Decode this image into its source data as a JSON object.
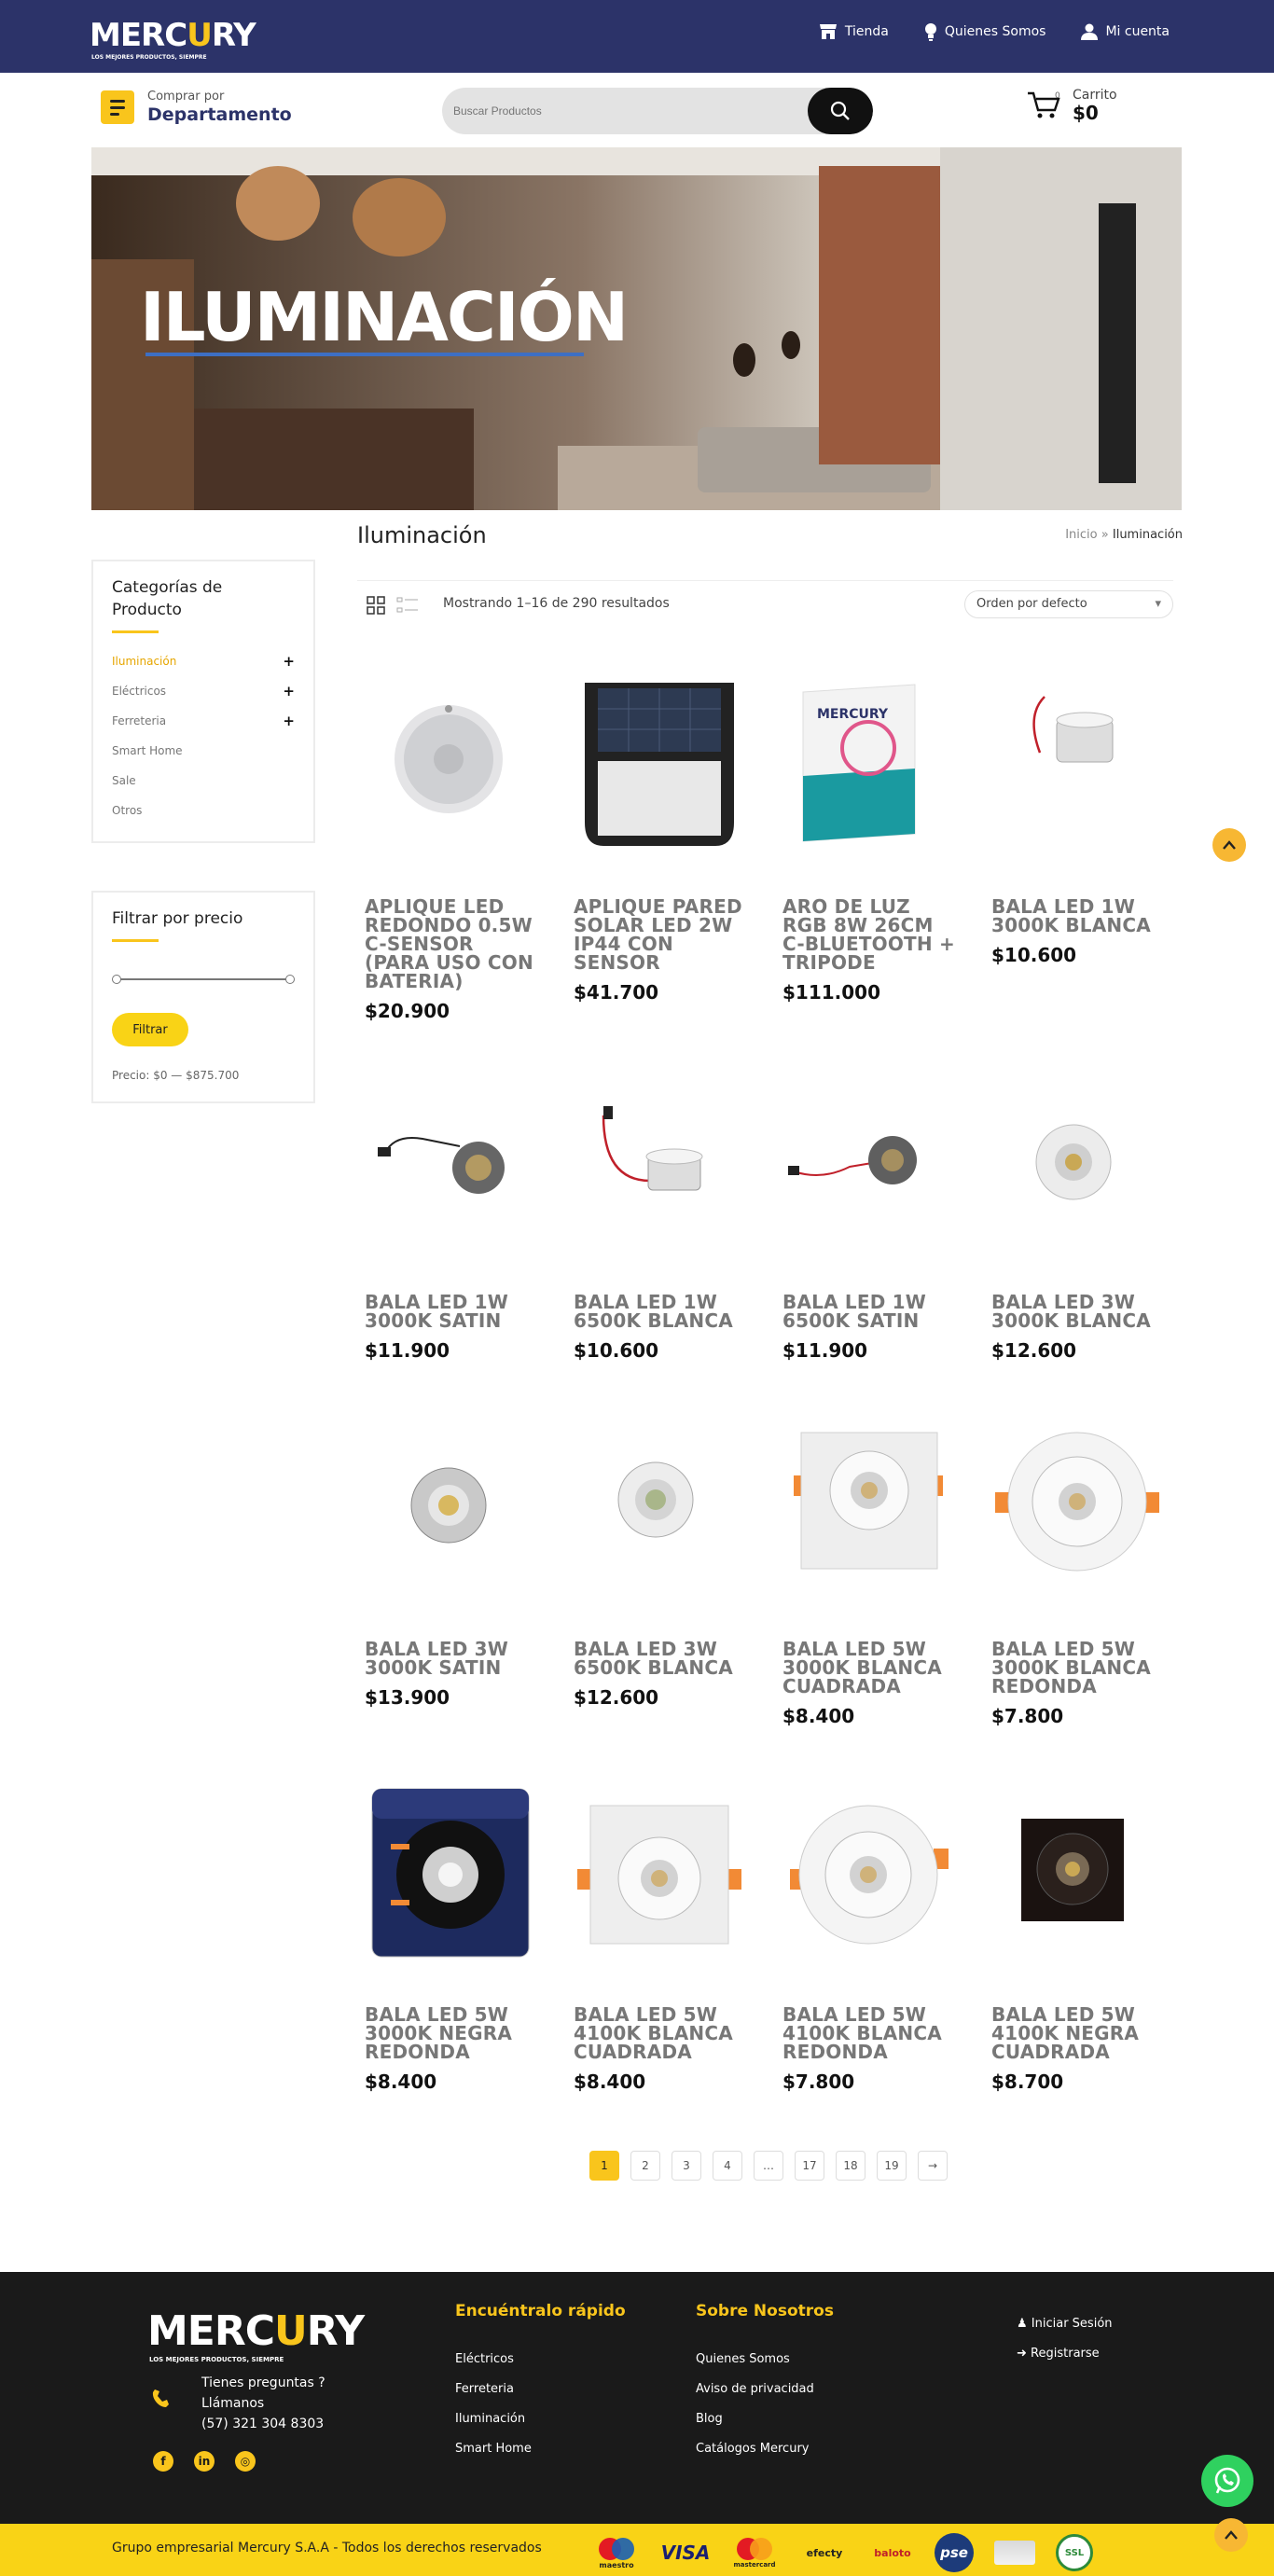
{
  "brand": {
    "logo_text": "MERCURY",
    "logo_tagline": "LOS MEJORES PRODUCTOS, SIEMPRE"
  },
  "topnav": [
    {
      "label": "Tienda",
      "icon": "store-icon"
    },
    {
      "label": "Quienes Somos",
      "icon": "lightbulb-icon"
    },
    {
      "label": "Mi cuenta",
      "icon": "user-icon"
    }
  ],
  "department": {
    "small": "Comprar por",
    "big": "Departamento"
  },
  "search": {
    "placeholder": "Buscar Productos"
  },
  "cart": {
    "label": "Carrito",
    "amount": "$0",
    "count": "0"
  },
  "banner": {
    "title": "ILUMINACIÓN"
  },
  "page": {
    "title": "Iluminación"
  },
  "breadcrumb": {
    "home": "Inicio",
    "sep": "»",
    "current": "Iluminación"
  },
  "categories": {
    "title": "Categorías de Producto",
    "items": [
      {
        "label": "Iluminación",
        "expand": "+"
      },
      {
        "label": "Eléctricos",
        "expand": "+"
      },
      {
        "label": "Ferreteria",
        "expand": "+"
      },
      {
        "label": "Smart Home",
        "expand": ""
      },
      {
        "label": "Sale",
        "expand": ""
      },
      {
        "label": "Otros",
        "expand": ""
      }
    ]
  },
  "price_filter": {
    "title": "Filtrar por precio",
    "button": "Filtrar",
    "range_text": "Precio: $0 — $875.700"
  },
  "toolbar": {
    "result_count": "Mostrando 1–16 de 290 resultados",
    "sort": "Orden por defecto"
  },
  "products": [
    {
      "name": "APLIQUE LED REDONDO 0.5W C-SENSOR (PARA USO CON BATERIA)",
      "price": "$20.900"
    },
    {
      "name": "APLIQUE PARED SOLAR LED 2W IP44 CON SENSOR",
      "price": "$41.700"
    },
    {
      "name": "ARO DE LUZ RGB 8W 26CM C-BLUETOOTH + TRIPODE",
      "price": "$111.000"
    },
    {
      "name": "BALA LED 1W 3000K BLANCA",
      "price": "$10.600"
    },
    {
      "name": "BALA LED 1W 3000K SATIN",
      "price": "$11.900"
    },
    {
      "name": "BALA LED 1W 6500K BLANCA",
      "price": "$10.600"
    },
    {
      "name": "BALA LED 1W 6500K SATIN",
      "price": "$11.900"
    },
    {
      "name": "BALA LED 3W 3000K BLANCA",
      "price": "$12.600"
    },
    {
      "name": "BALA LED 3W 3000K SATIN",
      "price": "$13.900"
    },
    {
      "name": "BALA LED 3W 6500K BLANCA",
      "price": "$12.600"
    },
    {
      "name": "BALA LED 5W 3000K BLANCA CUADRADA",
      "price": "$8.400"
    },
    {
      "name": "BALA LED 5W 3000K BLANCA REDONDA",
      "price": "$7.800"
    },
    {
      "name": "BALA LED 5W 3000K NEGRA REDONDA",
      "price": "$8.400"
    },
    {
      "name": "BALA LED 5W 4100K BLANCA CUADRADA",
      "price": "$8.400"
    },
    {
      "name": "BALA LED 5W 4100K BLANCA REDONDA",
      "price": "$7.800"
    },
    {
      "name": "BALA LED 5W 4100K NEGRA CUADRADA",
      "price": "$8.700"
    }
  ],
  "pagination": [
    "1",
    "2",
    "3",
    "4",
    "…",
    "17",
    "18",
    "19",
    "→"
  ],
  "footer": {
    "contact_q": "Tienes preguntas ?",
    "contact_call": "Llámanos",
    "phone": "(57) 321 304 8303",
    "quick": {
      "title": "Encuéntralo rápido",
      "links": [
        "Eléctricos",
        "Ferreteria",
        "Iluminación",
        "Smart Home"
      ]
    },
    "about": {
      "title": "Sobre Nosotros",
      "links": [
        "Quienes Somos",
        "Aviso de privacidad",
        "Blog",
        "Catálogos Mercury"
      ]
    },
    "account": [
      "Iniciar Sesión",
      "Registrarse"
    ],
    "copyright": "Grupo empresarial Mercury S.A.A - Todos los derechos reservados",
    "payments": [
      "maestro",
      "VISA",
      "mastercard",
      "efecty",
      "baloto",
      "pse",
      "",
      "SSL"
    ]
  },
  "colors": {
    "navy": "#2c3369",
    "yellow": "#f9c51c",
    "footer": "#1a1a1a"
  }
}
